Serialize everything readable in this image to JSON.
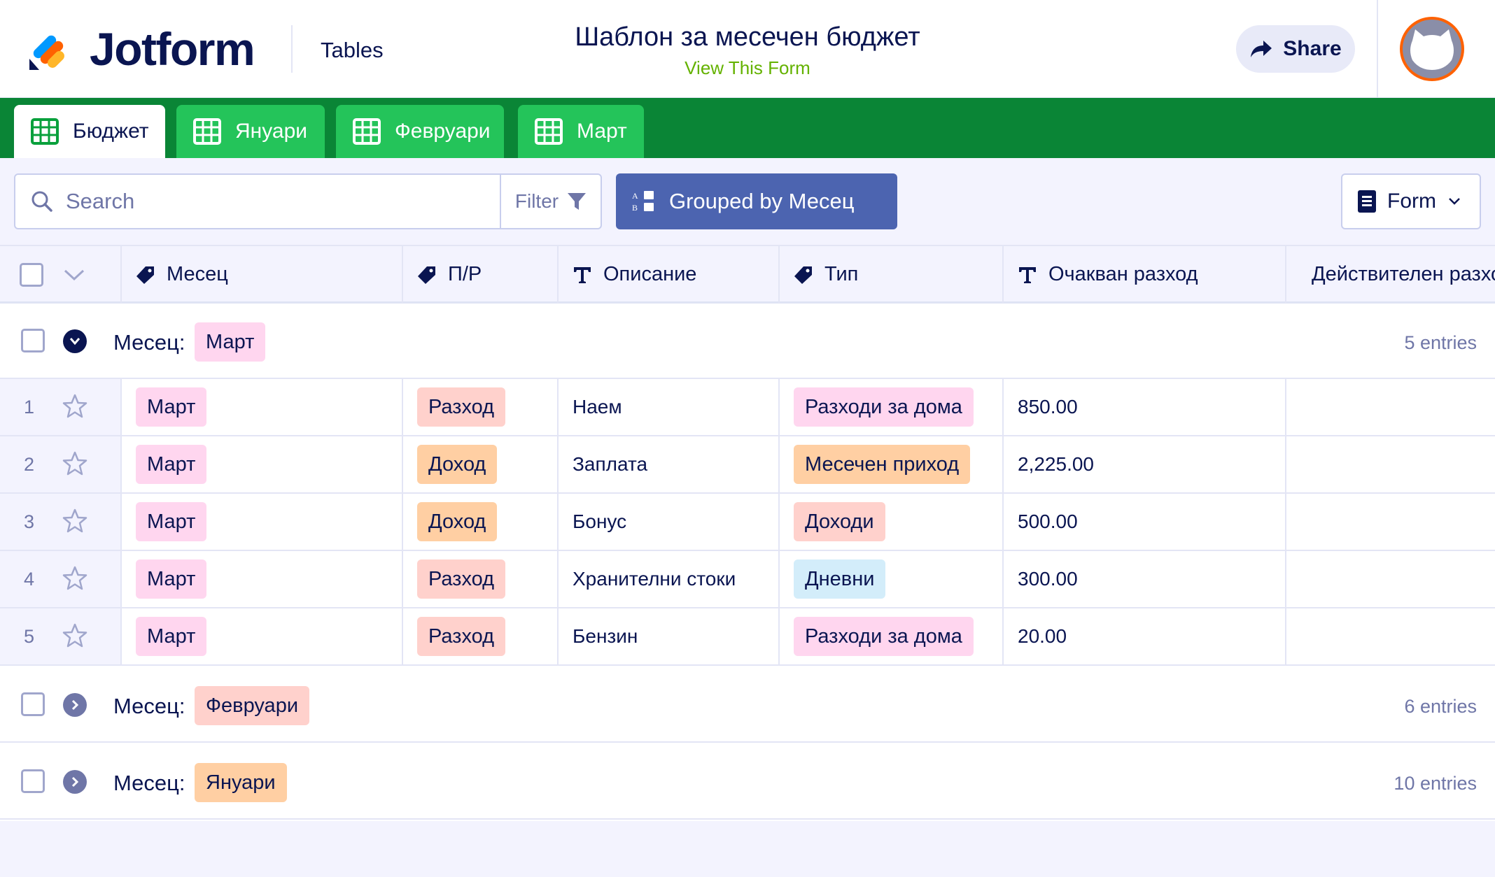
{
  "header": {
    "brand": "Jotform",
    "tables_link": "Tables",
    "form_title": "Шаблон за месечен бюджет",
    "view_form": "View This Form",
    "share_label": "Share"
  },
  "tabs": [
    {
      "label": "Бюджет",
      "active": true
    },
    {
      "label": "Януари",
      "active": false
    },
    {
      "label": "Февруари",
      "active": false
    },
    {
      "label": "Март",
      "active": false
    }
  ],
  "toolbar": {
    "search_placeholder": "Search",
    "filter_label": "Filter",
    "grouped_label": "Grouped by Месец",
    "form_label": "Form"
  },
  "columns": [
    {
      "label": "Месец",
      "icon": "tag-icon"
    },
    {
      "label": "П/Р",
      "icon": "tag-icon"
    },
    {
      "label": "Описание",
      "icon": "text-icon"
    },
    {
      "label": "Тип",
      "icon": "tag-icon"
    },
    {
      "label": "Очакван разход",
      "icon": "text-icon"
    },
    {
      "label": "Действителен разход",
      "icon": "number-icon"
    }
  ],
  "groups": [
    {
      "label": "Месец:",
      "value": "Март",
      "count": "5 entries",
      "expanded": true,
      "rows": [
        {
          "num": "1",
          "month": "Март",
          "pr": "Разход",
          "desc": "Наем",
          "type": "Разходи за дома",
          "expected": "850.00",
          "actual": ""
        },
        {
          "num": "2",
          "month": "Март",
          "pr": "Доход",
          "desc": "Заплата",
          "type": "Месечен приход",
          "expected": "2,225.00",
          "actual": ""
        },
        {
          "num": "3",
          "month": "Март",
          "pr": "Доход",
          "desc": "Бонус",
          "type": "Доходи",
          "expected": "500.00",
          "actual": ""
        },
        {
          "num": "4",
          "month": "Март",
          "pr": "Разход",
          "desc": "Хранителни стоки",
          "type": "Дневни",
          "expected": "300.00",
          "actual": ""
        },
        {
          "num": "5",
          "month": "Март",
          "pr": "Разход",
          "desc": "Бензин",
          "type": "Разходи за дома",
          "expected": "20.00",
          "actual": ""
        }
      ]
    },
    {
      "label": "Месец:",
      "value": "Февруари",
      "count": "6 entries",
      "expanded": false
    },
    {
      "label": "Месец:",
      "value": "Януари",
      "count": "10 entries",
      "expanded": false
    }
  ],
  "colors": {
    "brand_navy": "#0a1551",
    "tabbar_green": "#0a8536",
    "tab_green": "#24c45a",
    "view_form_green": "#64b200",
    "group_button": "#4c64b0",
    "tag_pink": "#ffd6ef",
    "tag_salmon": "#ffd1cc",
    "tag_peach": "#ffcfa3",
    "tag_blue": "#d3edfa"
  }
}
